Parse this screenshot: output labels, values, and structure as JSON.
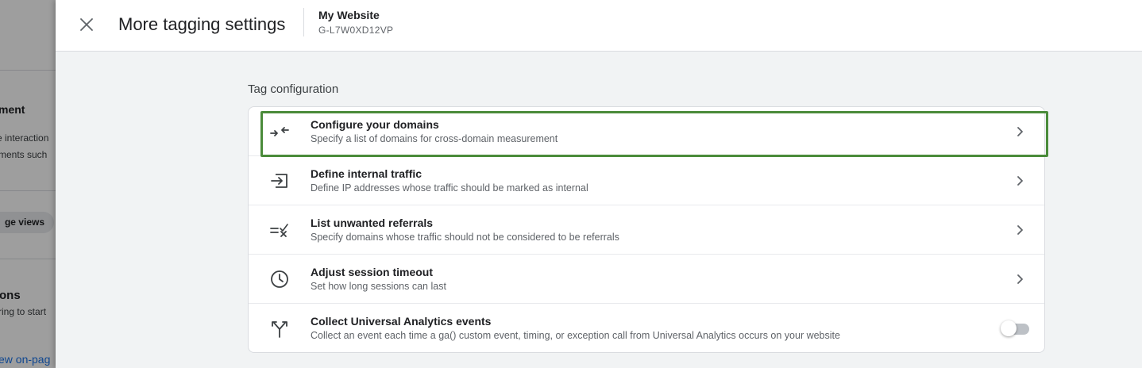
{
  "background": {
    "fragments": {
      "section1_title": "ment",
      "section1_line1": "e interaction",
      "section1_line2": "ments such",
      "chip": "ge views",
      "section2_title": "ons",
      "section2_line1": "ring to start",
      "link": "ew on-pag"
    }
  },
  "header": {
    "close_icon": "close-icon",
    "title": "More tagging settings",
    "property_name": "My Website",
    "property_id": "G-L7W0XD12VP"
  },
  "section": {
    "label": "Tag configuration"
  },
  "settings": [
    {
      "icon": "compress-arrows-icon",
      "title": "Configure your domains",
      "description": "Specify a list of domains for cross-domain measurement",
      "control": "chevron"
    },
    {
      "icon": "login-arrow-box-icon",
      "title": "Define internal traffic",
      "description": "Define IP addresses whose traffic should be marked as internal",
      "control": "chevron"
    },
    {
      "icon": "list-x-icon",
      "title": "List unwanted referrals",
      "description": "Specify domains whose traffic should not be considered to be referrals",
      "control": "chevron"
    },
    {
      "icon": "clock-icon",
      "title": "Adjust session timeout",
      "description": "Set how long sessions can last",
      "control": "chevron"
    },
    {
      "icon": "fork-arrows-icon",
      "title": "Collect Universal Analytics events",
      "description": "Collect an event each time a ga() custom event, timing, or exception call from Universal Analytics occurs on your website",
      "control": "toggle",
      "toggle_on": false
    }
  ],
  "colors": {
    "highlight": "#4a8b3a",
    "panel_bg": "#f1f3f4",
    "text_primary": "#202124",
    "text_secondary": "#5f6368",
    "link": "#1a73e8"
  }
}
